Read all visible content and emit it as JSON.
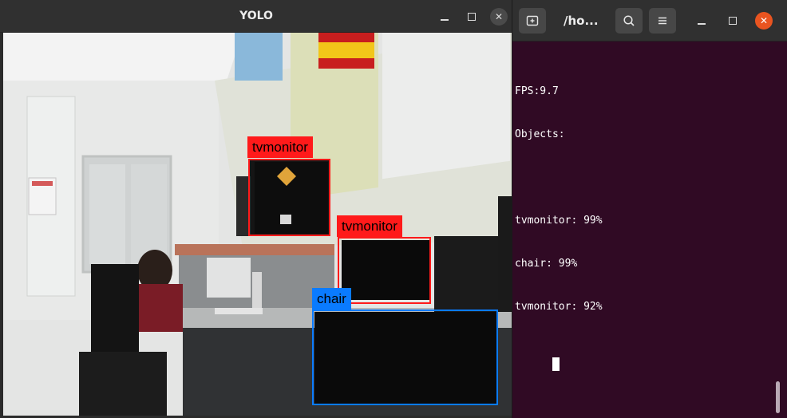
{
  "yolo_window": {
    "title": "YOLO",
    "controls": {
      "minimize_icon": "minimize-icon",
      "maximize_icon": "maximize-icon",
      "close_icon": "close-icon"
    },
    "detections": [
      {
        "label": "tvmonitor",
        "color": "#ff1a1a"
      },
      {
        "label": "tvmonitor",
        "color": "#ff1a1a"
      },
      {
        "label": "chair",
        "color": "#0a7bff"
      }
    ]
  },
  "terminal_window": {
    "title": "/ho...",
    "header_buttons": {
      "new_tab_icon": "new-tab-icon",
      "search_icon": "search-icon",
      "menu_icon": "hamburger-menu-icon"
    },
    "close_color": "#e95420",
    "output_lines": [
      "FPS:9.7",
      "Objects:",
      "",
      "tvmonitor: 99%",
      "chair: 99%",
      "tvmonitor: 92%"
    ]
  },
  "colors": {
    "terminal_background": "#300a24",
    "titlebar": "#303030",
    "detection_red": "#ff1a1a",
    "detection_blue": "#0a7bff"
  }
}
